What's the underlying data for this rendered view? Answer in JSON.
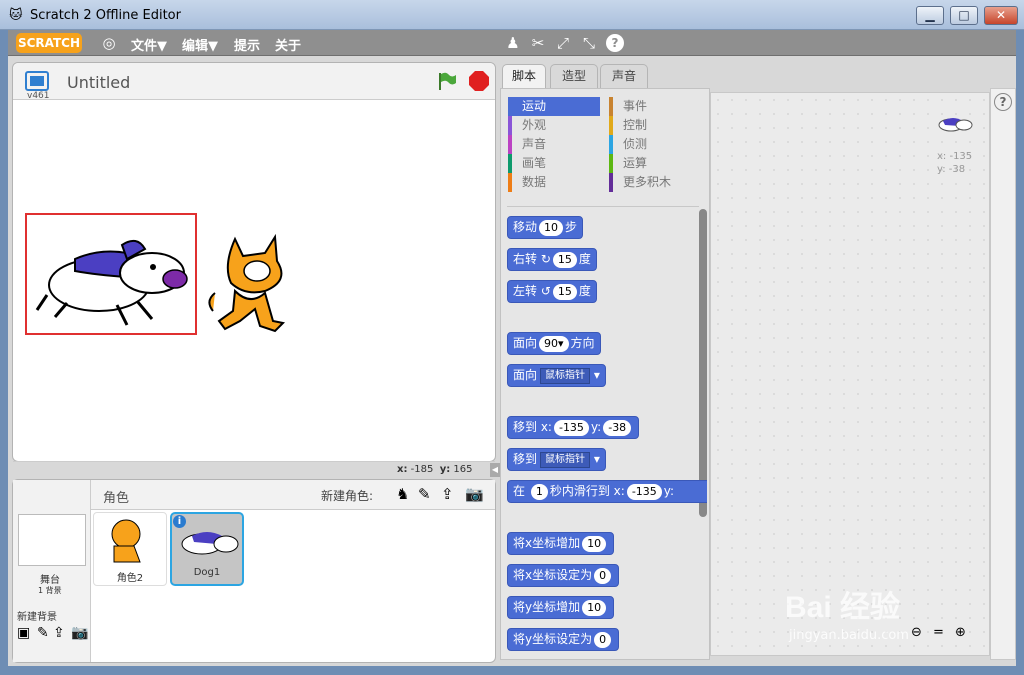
{
  "window": {
    "title": "Scratch 2 Offline Editor",
    "min": "▁",
    "max": "□",
    "close": "✕"
  },
  "menu": {
    "logo": "SCRATCH",
    "globe": "globe-icon",
    "file": "文件▼",
    "edit": "编辑▼",
    "tips": "提示",
    "about": "关于"
  },
  "toolbar": {
    "icons": [
      "duplicate-icon",
      "delete-icon",
      "grow-icon",
      "shrink-icon",
      "help-icon"
    ]
  },
  "stage": {
    "title": "Untitled",
    "version": "v461",
    "coords": {
      "x_label": "x:",
      "x": "-185",
      "y_label": "y:",
      "y": "165"
    }
  },
  "tabs": [
    "脚本",
    "造型",
    "声音"
  ],
  "categories": {
    "left": [
      "运动",
      "外观",
      "声音",
      "画笔",
      "数据"
    ],
    "right": [
      "事件",
      "控制",
      "侦测",
      "运算",
      "更多积木"
    ],
    "colors_left": [
      "#4a6cd4",
      "#8a55d7",
      "#bb42c3",
      "#0e9a6c",
      "#ee7d16"
    ],
    "colors_right": [
      "#c88330",
      "#e1a91a",
      "#2ca5e2",
      "#5cb712",
      "#632d99"
    ]
  },
  "blocks": {
    "move": {
      "a": "移动",
      "v": "10",
      "b": "步"
    },
    "turn_right": {
      "a": "右转",
      "v": "15",
      "b": "度"
    },
    "turn_left": {
      "a": "左转",
      "v": "15",
      "b": "度"
    },
    "point_dir": {
      "a": "面向",
      "v": "90▾",
      "b": "方向"
    },
    "point_towards": {
      "a": "面向",
      "v": "鼠标指针"
    },
    "goto_xy": {
      "a": "移到 x:",
      "x": "-135",
      "b": "y:",
      "y": "-38"
    },
    "goto": {
      "a": "移到",
      "v": "鼠标指针"
    },
    "glide": {
      "a": "在",
      "t": "1",
      "b": "秒内滑行到 x:",
      "x": "-135",
      "c": "y:"
    },
    "change_x": {
      "a": "将x坐标增加",
      "v": "10"
    },
    "set_x": {
      "a": "将x坐标设定为",
      "v": "0"
    },
    "change_y": {
      "a": "将y坐标增加",
      "v": "10"
    },
    "set_y": {
      "a": "将y坐标设定为",
      "v": "0"
    }
  },
  "scripts_area": {
    "x_label": "x: -135",
    "y_label": "y: -38"
  },
  "sprites": {
    "header": "角色",
    "new_sprite": "新建角色:",
    "stage_label": "舞台",
    "backdrop_count": "1 背景",
    "new_backdrop": "新建背景",
    "list": [
      "角色2",
      "Dog1"
    ]
  },
  "watermark": {
    "text": "Bai 经验",
    "url": "jingyan.baidu.com"
  }
}
